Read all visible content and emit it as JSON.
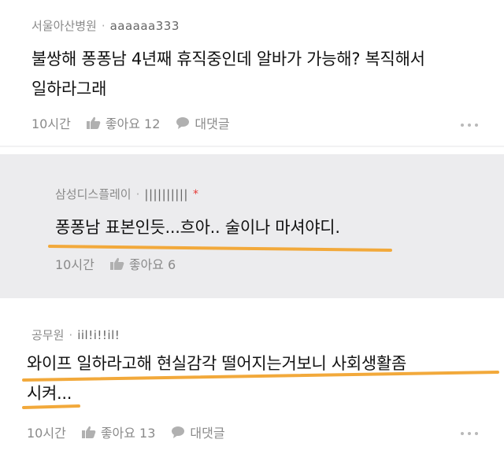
{
  "comments": [
    {
      "company": "서울아산병원",
      "nickname": "aaaaaa333",
      "text_line1": "불쌍해 퐁퐁남 4년째 휴직중인데 알바가 가능해? 복직해서",
      "text_line2": "일하라그래",
      "time": "10시간",
      "like_label": "좋아요 12",
      "reply_label": "대댓글"
    },
    {
      "company": "삼성디스플레이",
      "nickname": "||||||||||",
      "star": "*",
      "text_line1": "퐁퐁남 표본인듯...흐아.. 술이나 마셔야디.",
      "time": "10시간",
      "like_label": "좋아요 6"
    },
    {
      "company": "공무원",
      "nickname": "iil!i!!il!",
      "text_line1": "와이프 일하라고해 현실감각 떨어지는거보니 사회생활좀",
      "text_line2": "시켜...",
      "time": "10시간",
      "like_label": "좋아요 13",
      "reply_label": "대댓글"
    }
  ],
  "separator": "·",
  "colors": {
    "highlight": "#f2a93b",
    "reply_background": "#ececee"
  }
}
